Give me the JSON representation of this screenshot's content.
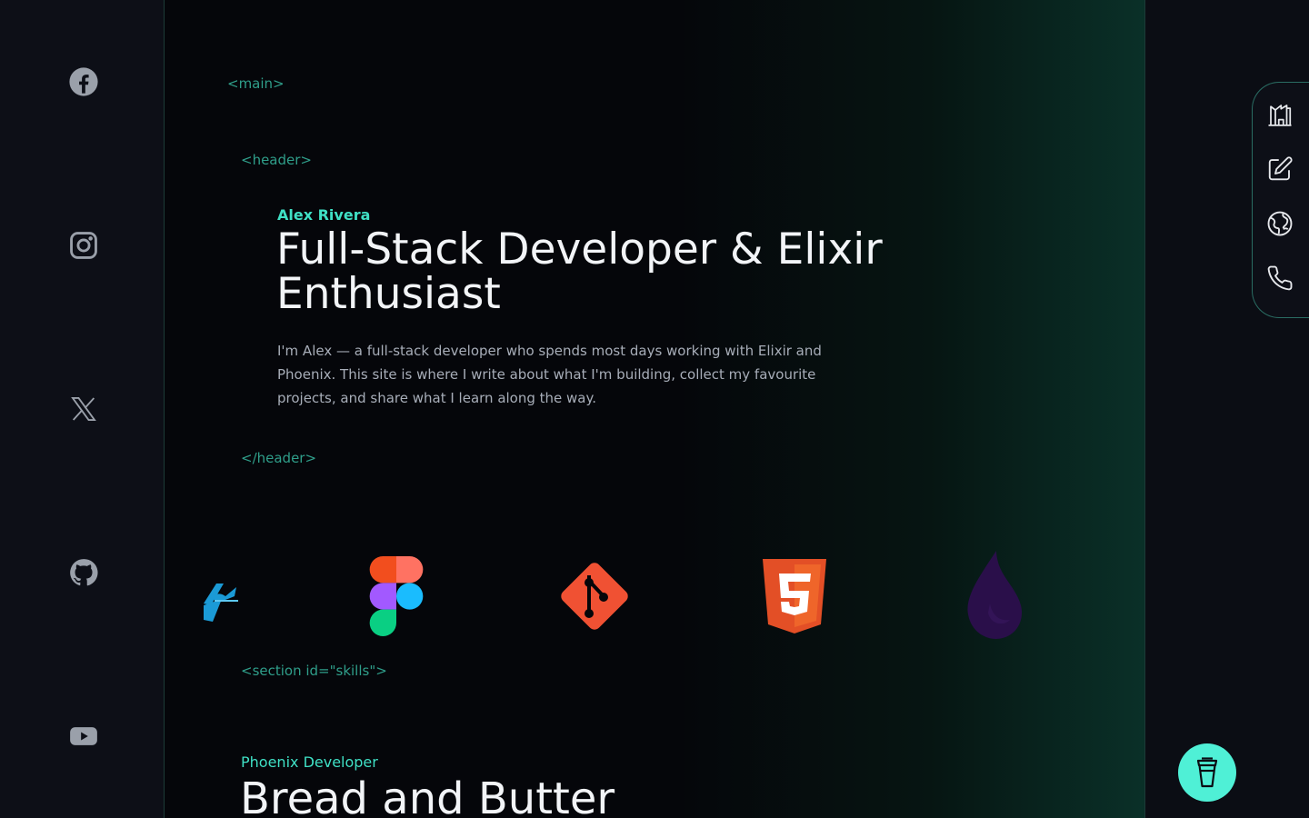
{
  "socials": [
    {
      "icon": "facebook-icon",
      "label": "Facebook"
    },
    {
      "icon": "instagram-icon",
      "label": "Instagram"
    },
    {
      "icon": "x-icon",
      "label": "X"
    },
    {
      "icon": "github-icon",
      "label": "GitHub"
    },
    {
      "icon": "youtube-icon",
      "label": "YouTube"
    }
  ],
  "markup_tags": {
    "main_open": "<main>",
    "header_open": "<header>",
    "header_close": "</header>",
    "section_skills_open": "<section id=\"skills\">"
  },
  "header": {
    "name": "Alex Rivera",
    "headline": "Full-Stack Developer & Elixir Enthusiast",
    "intro": "I'm Alex — a full-stack developer who spends most days working with Elixir and Phoenix. This site is where I write about what I'm building, collect my favourite projects, and share what I learn along the way."
  },
  "skill_logos": [
    "flutter-logo",
    "figma-logo",
    "git-logo",
    "html5-logo",
    "elixir-logo"
  ],
  "skills_section": {
    "role": "Phoenix Developer",
    "title": "Bread and Butter"
  },
  "right_nav": [
    {
      "icon": "home-icon"
    },
    {
      "icon": "edit-icon"
    },
    {
      "icon": "globe-icon"
    },
    {
      "icon": "phone-icon"
    }
  ],
  "coffee_button": {
    "icon": "coffee-cup-icon"
  },
  "colors": {
    "accent": "#3fe0c5",
    "tag": "#2f9e8a",
    "background": "#05060a",
    "coffee_button": "#4ff0d6"
  }
}
